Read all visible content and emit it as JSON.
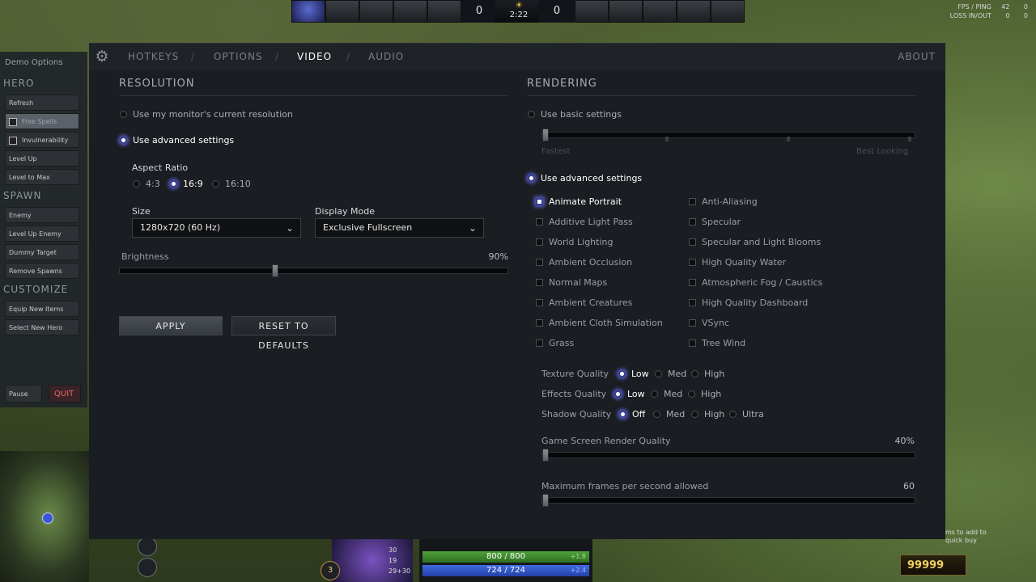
{
  "hud": {
    "radiant_score": "0",
    "dire_score": "0",
    "clock": "2:22",
    "fps_label": "FPS / PING",
    "fps_value": "42",
    "ping_value": "0",
    "loss_label": "LOSS IN/OUT",
    "loss_in": "0",
    "loss_out": "0",
    "hp": "800 / 800",
    "mana": "724 / 724",
    "hp_regen": "+1.8",
    "mana_regen": "+2.4",
    "gold": "99999",
    "level": "3",
    "stat_str": "30",
    "stat_agi": "19",
    "stat_int": "29+30",
    "quickbuy_hint_1": "ms to add to",
    "quickbuy_hint_2": "quick buy"
  },
  "demo": {
    "title": "Demo Options",
    "hero_heading": "HERO",
    "hero_buttons": [
      "Refresh",
      "Free Spells",
      "Invulnerability",
      "Level Up",
      "Level to Max"
    ],
    "spawn_heading": "SPAWN",
    "spawn_buttons": [
      "Enemy",
      "Level Up Enemy",
      "Dummy Target",
      "Remove Spawns"
    ],
    "customize_heading": "CUSTOMIZE",
    "customize_buttons": [
      "Equip New Items",
      "Select New Hero"
    ],
    "pause": "Pause",
    "quit": "QUIT"
  },
  "tabs": {
    "hotkeys": "HOTKEYS",
    "options": "OPTIONS",
    "video": "VIDEO",
    "audio": "AUDIO",
    "about": "ABOUT",
    "separator": "/"
  },
  "resolution": {
    "title": "RESOLUTION",
    "use_monitor": "Use my monitor's current resolution",
    "use_advanced": "Use advanced settings",
    "aspect_label": "Aspect Ratio",
    "aspect_options": [
      "4:3",
      "16:9",
      "16:10"
    ],
    "aspect_selected": "16:9",
    "size_label": "Size",
    "size_value": "1280x720 (60 Hz)",
    "display_mode_label": "Display Mode",
    "display_mode_value": "Exclusive Fullscreen",
    "brightness_label": "Brightness",
    "brightness_value": "90%",
    "brightness_fraction": 0.4,
    "apply": "APPLY",
    "reset": "RESET TO DEFAULTS"
  },
  "rendering": {
    "title": "RENDERING",
    "use_basic": "Use basic settings",
    "scale_fastest": "Fastest",
    "scale_best": "Best Looking",
    "use_advanced": "Use advanced settings",
    "left_checks": [
      {
        "label": "Animate Portrait",
        "checked": true
      },
      {
        "label": "Additive Light Pass",
        "checked": false
      },
      {
        "label": "World Lighting",
        "checked": false
      },
      {
        "label": "Ambient Occlusion",
        "checked": false
      },
      {
        "label": "Normal Maps",
        "checked": false
      },
      {
        "label": "Ambient Creatures",
        "checked": false
      },
      {
        "label": "Ambient Cloth Simulation",
        "checked": false
      },
      {
        "label": "Grass",
        "checked": false
      }
    ],
    "right_checks": [
      {
        "label": "Anti-Aliasing",
        "checked": false
      },
      {
        "label": "Specular",
        "checked": false
      },
      {
        "label": "Specular and Light Blooms",
        "checked": false
      },
      {
        "label": "High Quality Water",
        "checked": false
      },
      {
        "label": "Atmospheric Fog / Caustics",
        "checked": false
      },
      {
        "label": "High Quality Dashboard",
        "checked": false
      },
      {
        "label": "VSync",
        "checked": false
      },
      {
        "label": "Tree Wind",
        "checked": false
      }
    ],
    "texture_label": "Texture Quality",
    "texture_options": [
      "Low",
      "Med",
      "High"
    ],
    "effects_label": "Effects Quality",
    "effects_options": [
      "Low",
      "Med",
      "High"
    ],
    "shadow_label": "Shadow Quality",
    "shadow_options": [
      "Off",
      "Med",
      "High",
      "Ultra"
    ],
    "render_quality_label": "Game Screen Render Quality",
    "render_quality_value": "40%",
    "max_fps_label": "Maximum frames per second allowed",
    "max_fps_value": "60"
  }
}
